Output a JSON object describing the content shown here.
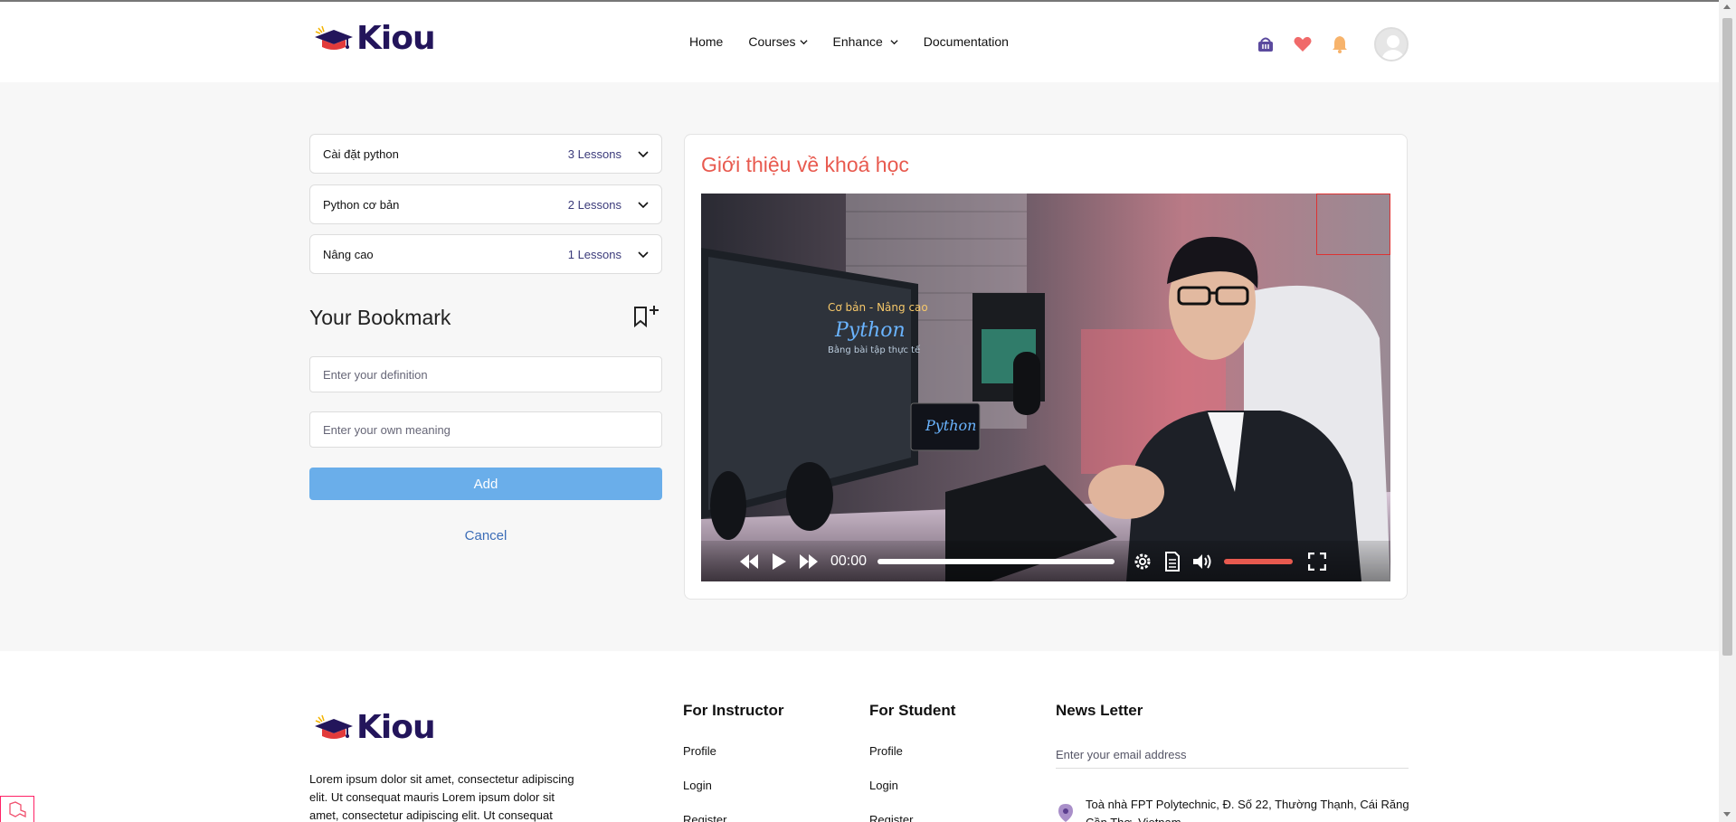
{
  "header": {
    "logo_text": "Kiou",
    "nav": [
      {
        "label": "Home"
      },
      {
        "label": "Courses"
      },
      {
        "label": "Enhance"
      },
      {
        "label": "Documentation"
      }
    ],
    "icons": [
      "basket-icon",
      "heart-icon",
      "bell-icon",
      "user-avatar"
    ]
  },
  "sidebar": {
    "sections": [
      {
        "title": "Cài đặt python",
        "count": "3 Lessons"
      },
      {
        "title": "Python cơ bản",
        "count": "2 Lessons"
      },
      {
        "title": "Nâng cao",
        "count": "1 Lessons"
      }
    ],
    "bookmark": {
      "title": "Your Bookmark",
      "definition_placeholder": "Enter your definition",
      "meaning_placeholder": "Enter your own meaning",
      "add_label": "Add",
      "cancel_label": "Cancel"
    }
  },
  "main": {
    "title": "Giới thiệu về khoá học",
    "video": {
      "time": "00:00",
      "progress": 0,
      "volume": 1.0,
      "screen_text": [
        "Cơ bản - Nâng cao",
        "Python",
        "Bằng bài tập thực tế"
      ]
    }
  },
  "footer": {
    "logo_text": "Kiou",
    "description": "Lorem ipsum dolor sit amet, consectetur adipiscing elit. Ut consequat mauris Lorem ipsum dolor sit amet, consectetur adipiscing elit. Ut consequat",
    "instructor": {
      "heading": "For Instructor",
      "links": [
        "Profile",
        "Login",
        "Register"
      ]
    },
    "student": {
      "heading": "For Student",
      "links": [
        "Profile",
        "Login",
        "Register"
      ]
    },
    "newsletter": {
      "heading": "News Letter",
      "placeholder": "Enter your email address",
      "address": "Toà nhà FPT Polytechnic, Đ. Số 22, Thường Thạnh, Cái Răng Cần Thơ, Vietnam"
    }
  },
  "colors": {
    "accent_red": "#e85a4f",
    "brand_navy": "#23155b",
    "add_button": "#6aaeea",
    "link_blue": "#3c6db7"
  }
}
